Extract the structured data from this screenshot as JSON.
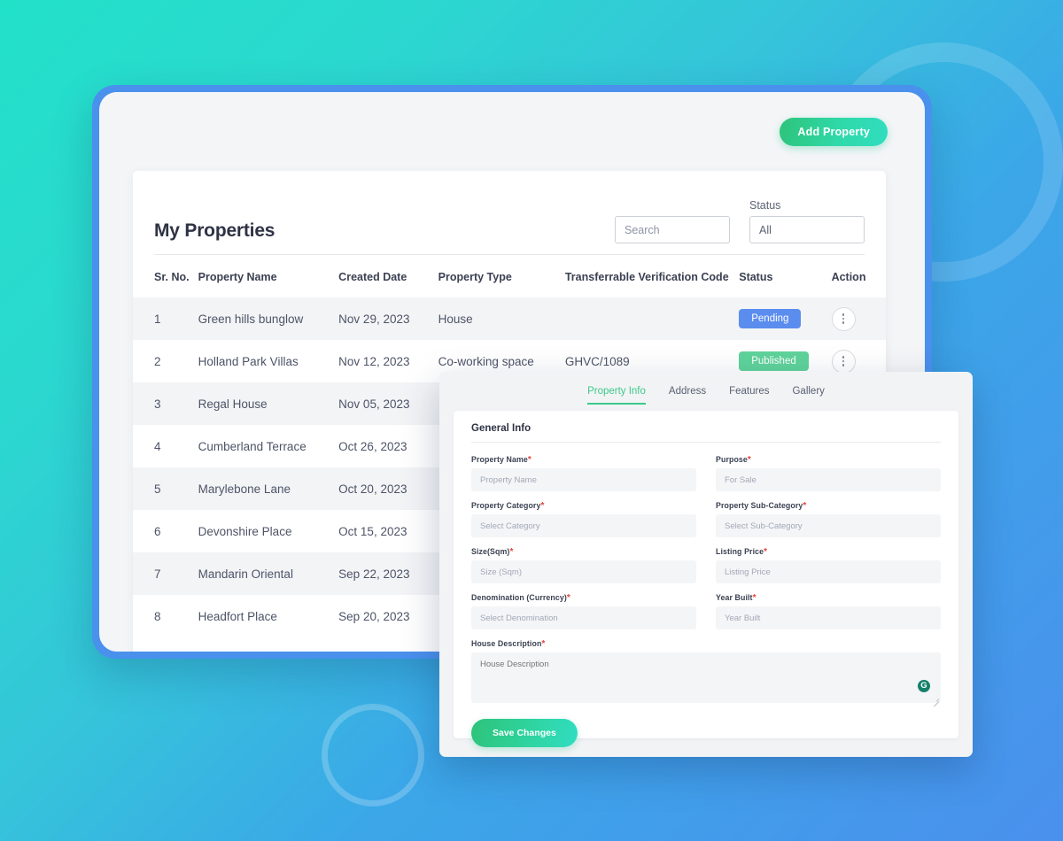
{
  "background": {
    "gradient_from": "#22e1c9",
    "gradient_to": "#4a90ed",
    "frame_color": "#4a90ed"
  },
  "toolbar": {
    "add_property_label": "Add Property"
  },
  "properties_card": {
    "title": "My Properties",
    "search": {
      "placeholder": "Search",
      "value": ""
    },
    "status_filter": {
      "label": "Status",
      "value": "All"
    },
    "columns": [
      "Sr. No.",
      "Property Name",
      "Created Date",
      "Property Type",
      "Transferrable Verification Code",
      "Status",
      "Action"
    ],
    "rows": [
      {
        "sr": "1",
        "name": "Green hills bunglow",
        "date": "Nov 29, 2023",
        "type": "House",
        "code": "",
        "status": "Pending",
        "status_color": "#5b8def"
      },
      {
        "sr": "2",
        "name": "Holland Park Villas",
        "date": "Nov 12, 2023",
        "type": "Co-working space",
        "code": "GHVC/1089",
        "status": "Published",
        "status_color": "#5fd39a"
      },
      {
        "sr": "3",
        "name": "Regal House",
        "date": "Nov 05, 2023",
        "type": "",
        "code": "",
        "status": "",
        "status_color": ""
      },
      {
        "sr": "4",
        "name": "Cumberland Terrace",
        "date": "Oct 26, 2023",
        "type": "",
        "code": "",
        "status": "",
        "status_color": ""
      },
      {
        "sr": "5",
        "name": "Marylebone Lane",
        "date": "Oct 20, 2023",
        "type": "",
        "code": "",
        "status": "",
        "status_color": ""
      },
      {
        "sr": "6",
        "name": "Devonshire Place",
        "date": "Oct 15, 2023",
        "type": "",
        "code": "",
        "status": "",
        "status_color": ""
      },
      {
        "sr": "7",
        "name": "Mandarin Oriental",
        "date": "Sep 22, 2023",
        "type": "",
        "code": "",
        "status": "",
        "status_color": ""
      },
      {
        "sr": "8",
        "name": "Headfort Place",
        "date": "Sep 20, 2023",
        "type": "",
        "code": "",
        "status": "",
        "status_color": ""
      }
    ]
  },
  "form_panel": {
    "tabs": [
      {
        "label": "Property Info",
        "active": true
      },
      {
        "label": "Address",
        "active": false
      },
      {
        "label": "Features",
        "active": false
      },
      {
        "label": "Gallery",
        "active": false
      }
    ],
    "active_tab_color": "#3ec98a",
    "section_title": "General Info",
    "fields": [
      {
        "label": "Property Name",
        "required": true,
        "placeholder": "Property Name",
        "value": ""
      },
      {
        "label": "Purpose",
        "required": true,
        "placeholder": "For Sale",
        "value": ""
      },
      {
        "label": "Property Category",
        "required": true,
        "placeholder": "Select Category",
        "value": ""
      },
      {
        "label": "Property Sub-Category",
        "required": true,
        "placeholder": "Select Sub-Category",
        "value": ""
      },
      {
        "label": "Size(Sqm)",
        "required": true,
        "placeholder": "Size (Sqm)",
        "value": ""
      },
      {
        "label": "Listing Price",
        "required": true,
        "placeholder": "Listing Price",
        "value": ""
      },
      {
        "label": "Denomination (Currency)",
        "required": true,
        "placeholder": "Select Denomination",
        "value": ""
      },
      {
        "label": "Year Built",
        "required": true,
        "placeholder": "Year Built",
        "value": ""
      }
    ],
    "description": {
      "label": "House Description",
      "required": true,
      "placeholder": "House Description",
      "value": ""
    },
    "grammarly_icon_label": "G",
    "save_label": "Save Changes"
  }
}
